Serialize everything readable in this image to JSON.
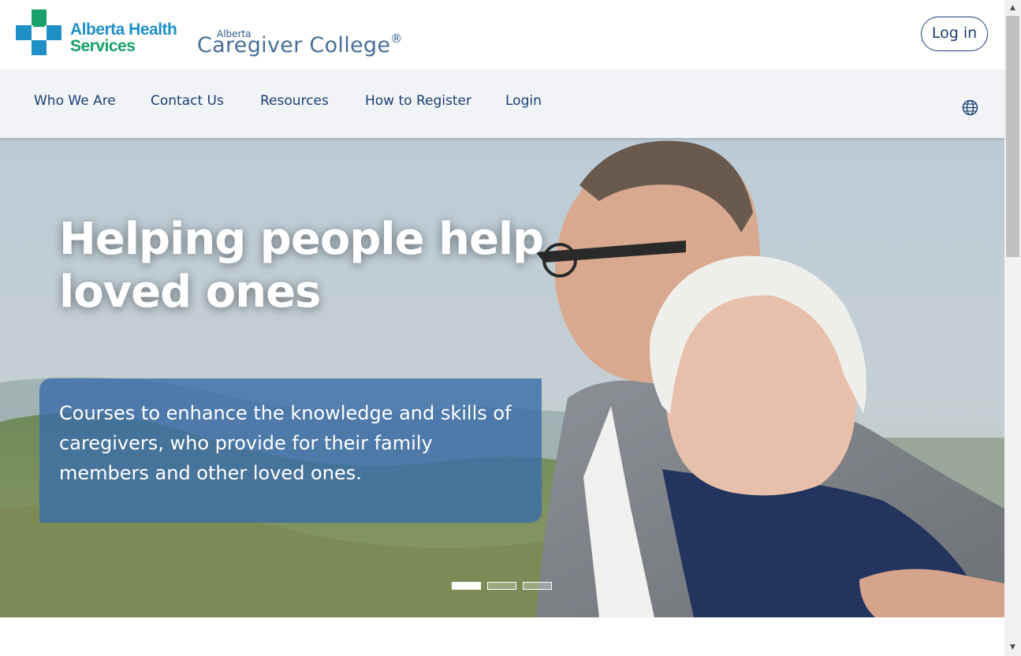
{
  "header": {
    "ahs_logo_line1": "Alberta Health",
    "ahs_logo_line2": "Services",
    "college_logo_small": "Alberta",
    "college_logo_big": "Caregiver College",
    "college_logo_mark": "®",
    "login_button": "Log in"
  },
  "nav": {
    "items": [
      {
        "label": "Who We Are"
      },
      {
        "label": "Contact Us"
      },
      {
        "label": "Resources"
      },
      {
        "label": "How to Register"
      },
      {
        "label": "Login"
      }
    ],
    "language_icon": "globe-icon"
  },
  "hero": {
    "title": "Helping people help loved ones",
    "subtitle": "Courses to enhance the knowledge and skills of caregivers, who provide for their family members and other loved ones.",
    "carousel": {
      "count": 3,
      "active_index": 0
    }
  },
  "colors": {
    "brand_navy": "#1a3f73",
    "ahs_blue": "#1f8fc7",
    "ahs_green": "#18a06a",
    "nav_bg": "#f2f3f7",
    "hero_box": "#3a6ea7"
  }
}
